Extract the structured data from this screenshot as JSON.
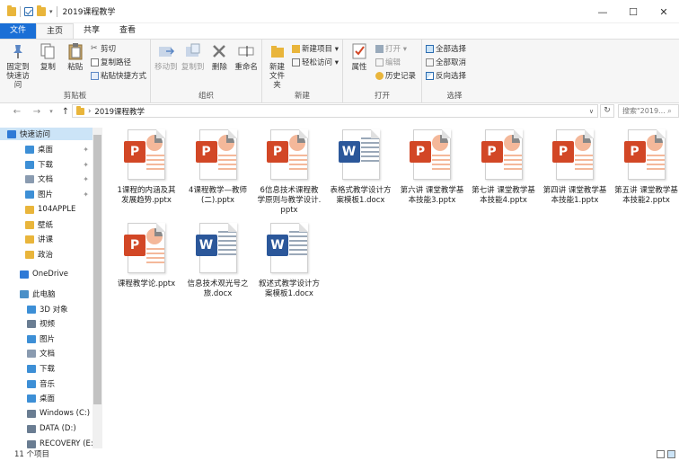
{
  "window": {
    "title": "2019课程教学"
  },
  "tabs": [
    {
      "label": "文件"
    },
    {
      "label": "主页"
    },
    {
      "label": "共享"
    },
    {
      "label": "查看"
    }
  ],
  "ribbon": {
    "clipboard": {
      "title": "剪贴板",
      "pin": "固定到\n快速访问",
      "copy": "复制",
      "paste": "粘贴",
      "cut": "剪切",
      "copy_path": "复制路径",
      "paste_shortcut": "粘贴快捷方式"
    },
    "organize": {
      "title": "组织",
      "move_to": "移动到",
      "copy_to": "复制到",
      "delete": "删除",
      "rename": "重命名"
    },
    "new": {
      "title": "新建",
      "new_folder": "新建\n文件夹",
      "new_item": "新建项目 ▾",
      "easy_access": "轻松访问 ▾"
    },
    "open": {
      "title": "打开",
      "properties": "属性",
      "open": "打开 ▾",
      "edit": "编辑",
      "history": "历史记录"
    },
    "select": {
      "title": "选择",
      "select_all": "全部选择",
      "select_none": "全部取消",
      "invert": "反向选择"
    }
  },
  "address": {
    "path": "2019课程教学",
    "search_placeholder": "搜索\"2019..."
  },
  "sidebar": {
    "items": [
      {
        "label": "快速访问",
        "color": "#2f7ad6"
      },
      {
        "label": "桌面",
        "color": "#3d8fd6"
      },
      {
        "label": "下载",
        "color": "#3d8fd6"
      },
      {
        "label": "文档",
        "color": "#8a9bb0"
      },
      {
        "label": "图片",
        "color": "#3d8fd6"
      },
      {
        "label": "104APPLE",
        "color": "#e9b53b"
      },
      {
        "label": "壁纸",
        "color": "#e9b53b"
      },
      {
        "label": "讲课",
        "color": "#e9b53b"
      },
      {
        "label": "政治",
        "color": "#e9b53b"
      },
      {
        "label": "OneDrive",
        "color": "#2f7ad6"
      },
      {
        "label": "此电脑",
        "color": "#4a90c8"
      },
      {
        "label": "3D 对象",
        "color": "#3d8fd6"
      },
      {
        "label": "视频",
        "color": "#6a7d92"
      },
      {
        "label": "图片",
        "color": "#3d8fd6"
      },
      {
        "label": "文档",
        "color": "#8a9bb0"
      },
      {
        "label": "下载",
        "color": "#3d8fd6"
      },
      {
        "label": "音乐",
        "color": "#3d8fd6"
      },
      {
        "label": "桌面",
        "color": "#3d8fd6"
      },
      {
        "label": "Windows (C:)",
        "color": "#6a7d92"
      },
      {
        "label": "DATA (D:)",
        "color": "#6a7d92"
      },
      {
        "label": "RECOVERY (E:)",
        "color": "#6a7d92"
      }
    ]
  },
  "files": [
    {
      "name": "1课程的内涵及其发展趋势.pptx",
      "type": "P"
    },
    {
      "name": "4课程教学—教师(二).pptx",
      "type": "P"
    },
    {
      "name": "6信息技术课程教学原则与教学设计.pptx",
      "type": "P"
    },
    {
      "name": "表格式教学设计方案模板1.docx",
      "type": "W"
    },
    {
      "name": "第六讲 课堂教学基本技能3.pptx",
      "type": "P"
    },
    {
      "name": "第七讲 课堂教学基本技能4.pptx",
      "type": "P"
    },
    {
      "name": "第四讲 课堂教学基本技能1.pptx",
      "type": "P"
    },
    {
      "name": "第五讲 课堂教学基本技能2.pptx",
      "type": "P"
    },
    {
      "name": "课程教学论.pptx",
      "type": "P"
    },
    {
      "name": "信息技术观光号之旅.docx",
      "type": "W"
    },
    {
      "name": "叙述式教学设计方案模板1.docx",
      "type": "W"
    }
  ],
  "status": {
    "count": "11 个项目"
  }
}
